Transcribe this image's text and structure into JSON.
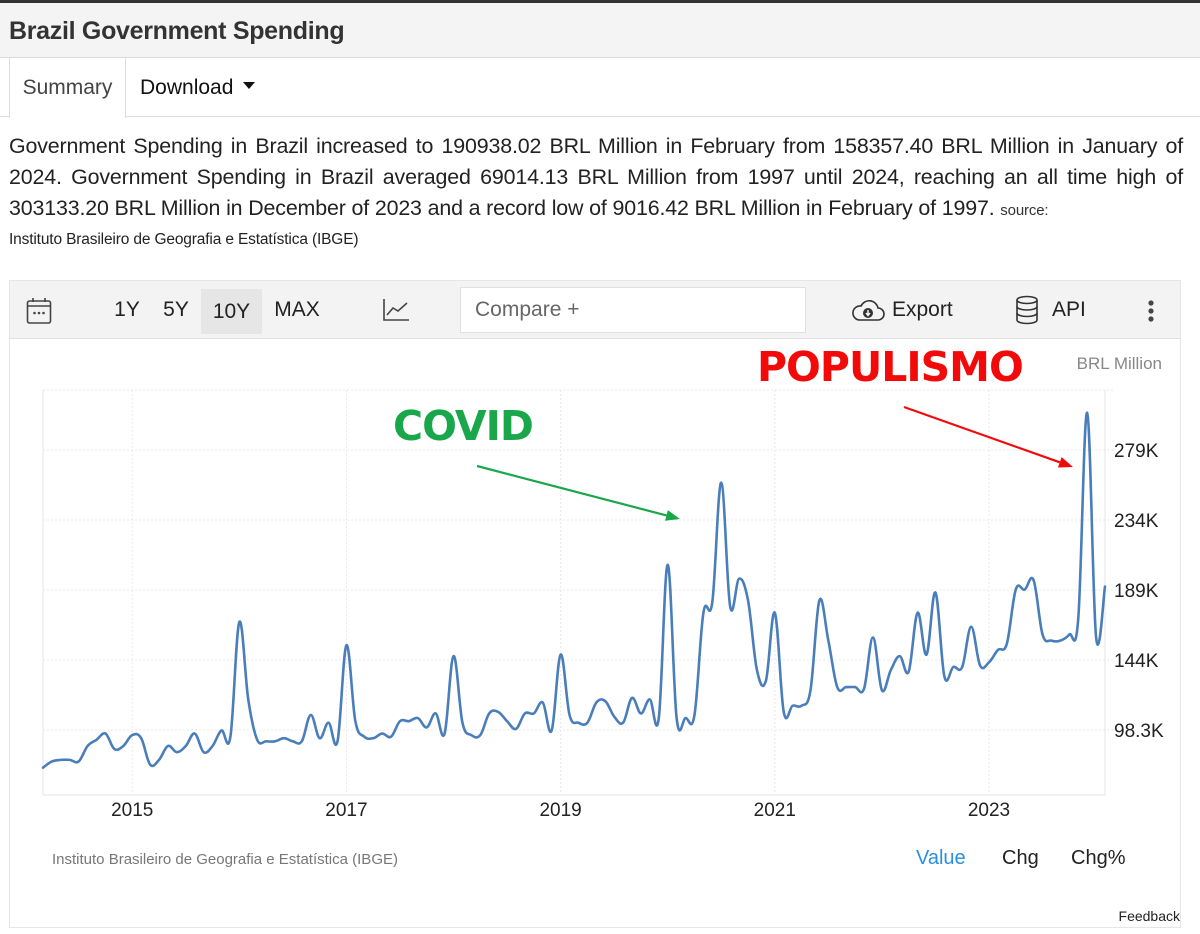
{
  "header": {
    "title": "Brazil Government Spending"
  },
  "tabs": [
    {
      "label": "Summary",
      "active": true
    },
    {
      "label": "Download",
      "has_dropdown": true
    }
  ],
  "summary": {
    "text": "Government Spending in Brazil increased to 190938.02 BRL Million in February from 158357.40 BRL Million in January of 2024. Government Spending in Brazil averaged 69014.13 BRL Million from 1997 until 2024, reaching an all time high of 303133.20 BRL Million in December of 2023 and a record low of 9016.42 BRL Million in February of 1997.",
    "source_label": "source:",
    "source_name": "Instituto Brasileiro de Geografia e Estatística (IBGE)"
  },
  "toolbar": {
    "calendar_icon": "calendar-icon",
    "ranges": [
      "1Y",
      "5Y",
      "10Y",
      "MAX"
    ],
    "active_range": "10Y",
    "chart_type_icon": "line-chart-icon",
    "compare_placeholder": "Compare +",
    "export_label": "Export",
    "export_icon": "cloud-download-icon",
    "api_label": "API",
    "api_icon": "database-icon",
    "more_icon": "vertical-ellipsis-icon"
  },
  "footer": {
    "source": "Instituto Brasileiro de Geografia e Estatística (IBGE)",
    "view_tabs": [
      "Value",
      "Chg",
      "Chg%"
    ],
    "active_view": "Value",
    "feedback": "Feedback"
  },
  "colors": {
    "line": "#4a7ebb",
    "active_view": "#2b8ee0",
    "covid_annotation": "#1aa64a",
    "populismo_annotation": "#f20a0a"
  },
  "chart_data": {
    "type": "line",
    "title": "Brazil Government Spending",
    "unit_label": "BRL Million",
    "xlabel": "",
    "ylabel": "BRL Million",
    "x_start": "2014-03",
    "x_end": "2024-02",
    "x_ticks": [
      "2015",
      "2017",
      "2019",
      "2021",
      "2023"
    ],
    "y_ticks": [
      "98.3K",
      "144K",
      "189K",
      "234K",
      "279K"
    ],
    "y_tick_values": [
      98300,
      143500,
      188700,
      233900,
      279100
    ],
    "ylim": [
      54000,
      318000
    ],
    "grid": true,
    "legend": "none",
    "series": [
      {
        "name": "Government Spending",
        "unit": "thousand BRL Million",
        "x": [
          "2014-03",
          "2014-04",
          "2014-05",
          "2014-06",
          "2014-07",
          "2014-08",
          "2014-09",
          "2014-10",
          "2014-11",
          "2014-12",
          "2015-01",
          "2015-02",
          "2015-03",
          "2015-04",
          "2015-05",
          "2015-06",
          "2015-07",
          "2015-08",
          "2015-09",
          "2015-10",
          "2015-11",
          "2015-12",
          "2016-01",
          "2016-02",
          "2016-03",
          "2016-04",
          "2016-05",
          "2016-06",
          "2016-07",
          "2016-08",
          "2016-09",
          "2016-10",
          "2016-11",
          "2016-12",
          "2017-01",
          "2017-02",
          "2017-03",
          "2017-04",
          "2017-05",
          "2017-06",
          "2017-07",
          "2017-08",
          "2017-09",
          "2017-10",
          "2017-11",
          "2017-12",
          "2018-01",
          "2018-02",
          "2018-03",
          "2018-04",
          "2018-05",
          "2018-06",
          "2018-07",
          "2018-08",
          "2018-09",
          "2018-10",
          "2018-11",
          "2018-12",
          "2019-01",
          "2019-02",
          "2019-03",
          "2019-04",
          "2019-05",
          "2019-06",
          "2019-07",
          "2019-08",
          "2019-09",
          "2019-10",
          "2019-11",
          "2019-12",
          "2020-01",
          "2020-02",
          "2020-03",
          "2020-04",
          "2020-05",
          "2020-06",
          "2020-07",
          "2020-08",
          "2020-09",
          "2020-10",
          "2020-11",
          "2020-12",
          "2021-01",
          "2021-02",
          "2021-03",
          "2021-04",
          "2021-05",
          "2021-06",
          "2021-07",
          "2021-08",
          "2021-09",
          "2021-10",
          "2021-11",
          "2021-12",
          "2022-01",
          "2022-02",
          "2022-03",
          "2022-04",
          "2022-05",
          "2022-06",
          "2022-07",
          "2022-08",
          "2022-09",
          "2022-10",
          "2022-11",
          "2022-12",
          "2023-01",
          "2023-02",
          "2023-03",
          "2023-04",
          "2023-05",
          "2023-06",
          "2023-07",
          "2023-08",
          "2023-09",
          "2023-10",
          "2023-11",
          "2023-12",
          "2024-01",
          "2024-02"
        ],
        "values": [
          74,
          78,
          79,
          79,
          78,
          88,
          92,
          96,
          86,
          88,
          95,
          93,
          76,
          79,
          88,
          84,
          88,
          96,
          84,
          88,
          98,
          94,
          168,
          118,
          92,
          91,
          91,
          93,
          91,
          91,
          108,
          93,
          103,
          91,
          153,
          104,
          94,
          93,
          96,
          94,
          104,
          104,
          106,
          100,
          109,
          96,
          146,
          103,
          95,
          95,
          109,
          110,
          104,
          99,
          109,
          109,
          116,
          98,
          147,
          108,
          103,
          103,
          116,
          117,
          107,
          103,
          119,
          109,
          118,
          106,
          205,
          106,
          106,
          108,
          174,
          181,
          258,
          178,
          196,
          182,
          137,
          130,
          174,
          110,
          114,
          114,
          124,
          182,
          156,
          126,
          126,
          126,
          125,
          158,
          124,
          137,
          146,
          136,
          174,
          147,
          187,
          133,
          139,
          139,
          165,
          140,
          142,
          150,
          154,
          189,
          189,
          195,
          160,
          156,
          156,
          160,
          170,
          303.1,
          158.4,
          190.9
        ]
      }
    ],
    "annotations": [
      {
        "text": "COVID",
        "points_to": "2020-07",
        "color": "#1aa64a"
      },
      {
        "text": "POPULISMO",
        "points_to": "2023-12",
        "color": "#f20a0a"
      }
    ]
  }
}
